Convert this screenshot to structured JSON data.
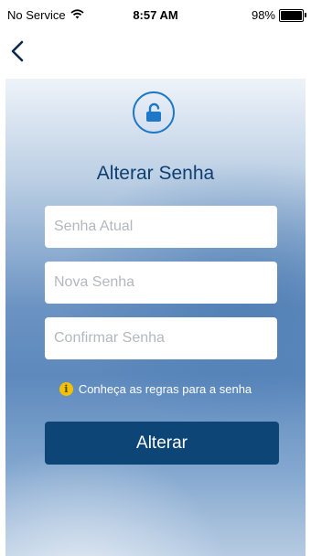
{
  "status_bar": {
    "carrier": "No Service",
    "time": "8:57 AM",
    "battery": "98%",
    "battery_level": 0.98
  },
  "nav": {
    "back_icon": "chevron-left-icon"
  },
  "form": {
    "icon": "unlock-icon",
    "title": "Alterar Senha",
    "current_password": {
      "value": "",
      "placeholder": "Senha Atual"
    },
    "new_password": {
      "value": "",
      "placeholder": "Nova Senha"
    },
    "confirm_password": {
      "value": "",
      "placeholder": "Confirmar Senha"
    },
    "rules_link": "Conheça as regras para a senha",
    "submit_label": "Alterar"
  },
  "colors": {
    "accent": "#1d78c8",
    "title": "#0f3f70",
    "button": "#0c4576",
    "info": "#f2c200"
  }
}
